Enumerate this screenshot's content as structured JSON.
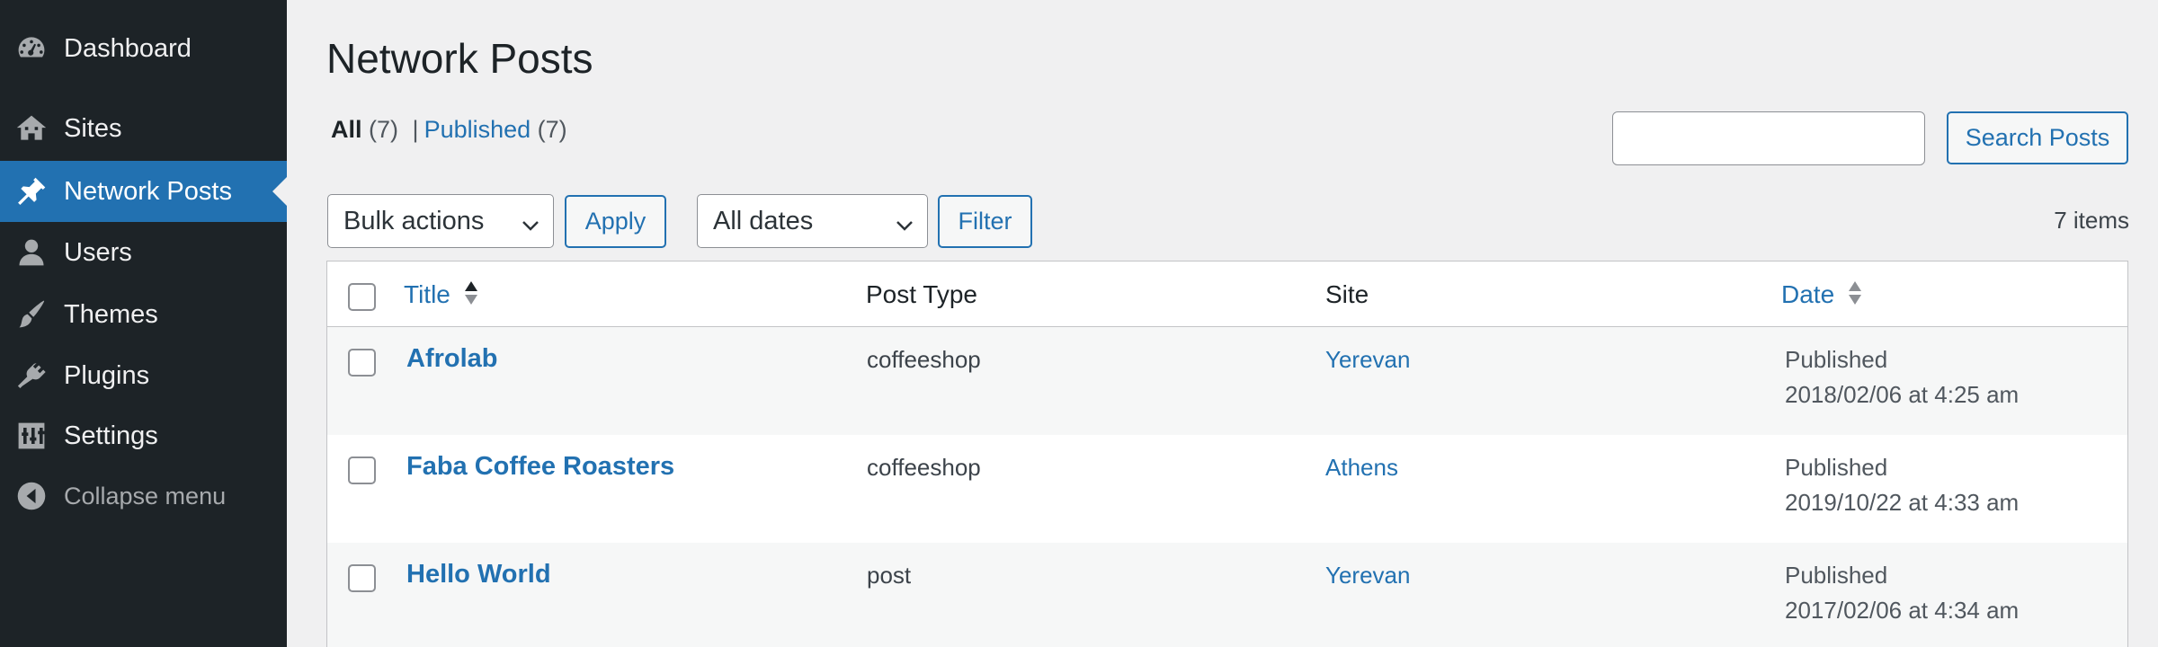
{
  "sidebar": {
    "items": [
      {
        "label": "Dashboard",
        "icon": "dashboard-icon",
        "active": false
      },
      {
        "label": "Sites",
        "icon": "sites-icon",
        "active": false
      },
      {
        "label": "Network Posts",
        "icon": "pin-icon",
        "active": true
      },
      {
        "label": "Users",
        "icon": "user-icon",
        "active": false
      },
      {
        "label": "Themes",
        "icon": "brush-icon",
        "active": false
      },
      {
        "label": "Plugins",
        "icon": "plugin-icon",
        "active": false
      },
      {
        "label": "Settings",
        "icon": "settings-icon",
        "active": false
      }
    ],
    "collapse_label": "Collapse menu"
  },
  "page": {
    "title": "Network Posts"
  },
  "filters": {
    "all_label": "All",
    "all_count": "(7)",
    "separator": "|",
    "published_label": "Published",
    "published_count": "(7)"
  },
  "search": {
    "value": "",
    "button_label": "Search Posts"
  },
  "toolbar": {
    "bulk_actions": "Bulk actions",
    "apply_label": "Apply",
    "dates": "All dates",
    "filter_label": "Filter",
    "items_count": "7 items"
  },
  "table": {
    "columns": {
      "title": "Title",
      "post_type": "Post Type",
      "site": "Site",
      "date": "Date"
    },
    "rows": [
      {
        "title": "Afrolab",
        "post_type": "coffeeshop",
        "site": "Yerevan",
        "status": "Published",
        "date": "2018/02/06 at 4:25 am"
      },
      {
        "title": "Faba Coffee Roasters",
        "post_type": "coffeeshop",
        "site": "Athens",
        "status": "Published",
        "date": "2019/10/22 at 4:33 am"
      },
      {
        "title": "Hello World",
        "post_type": "post",
        "site": "Yerevan",
        "status": "Published",
        "date": "2017/02/06 at 4:34 am"
      }
    ]
  },
  "colors": {
    "sidebar_bg": "#1d2327",
    "accent": "#2271b1",
    "page_bg": "#f0f0f1"
  }
}
